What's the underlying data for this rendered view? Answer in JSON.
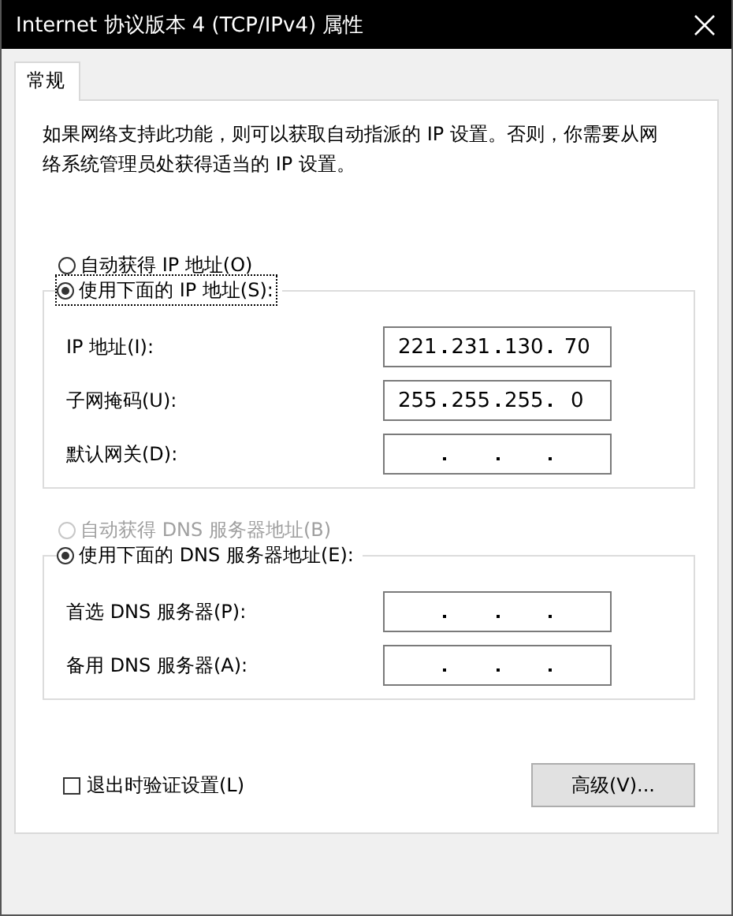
{
  "window": {
    "title": "Internet 协议版本 4 (TCP/IPv4) 属性"
  },
  "tabs": [
    {
      "label": "常规",
      "selected": true
    }
  ],
  "description": "如果网络支持此功能，则可以获取自动指派的 IP 设置。否则，你需要从网络系统管理员处获得适当的 IP 设置。",
  "ip_section": {
    "options": [
      {
        "label": "自动获得 IP 地址(O)",
        "selected": false,
        "disabled": false,
        "focused": false
      },
      {
        "label": "使用下面的 IP 地址(S):",
        "selected": true,
        "disabled": false,
        "focused": true
      }
    ],
    "fields": [
      {
        "label": "IP 地址(I):",
        "octets": [
          "221",
          "231",
          "130",
          "70"
        ]
      },
      {
        "label": "子网掩码(U):",
        "octets": [
          "255",
          "255",
          "255",
          "0"
        ]
      },
      {
        "label": "默认网关(D):"
      }
    ]
  },
  "dns_section": {
    "options": [
      {
        "label": "自动获得 DNS 服务器地址(B)",
        "selected": false,
        "disabled": true,
        "focused": false
      },
      {
        "label": "使用下面的 DNS 服务器地址(E):",
        "selected": true,
        "disabled": false,
        "focused": false
      }
    ],
    "fields": [
      {
        "label": "首选 DNS 服务器(P):"
      },
      {
        "label": "备用 DNS 服务器(A):"
      }
    ]
  },
  "validate_on_exit": {
    "label": "退出时验证设置(L)",
    "checked": false
  },
  "buttons": [
    {
      "label": "高级(V)..."
    }
  ]
}
